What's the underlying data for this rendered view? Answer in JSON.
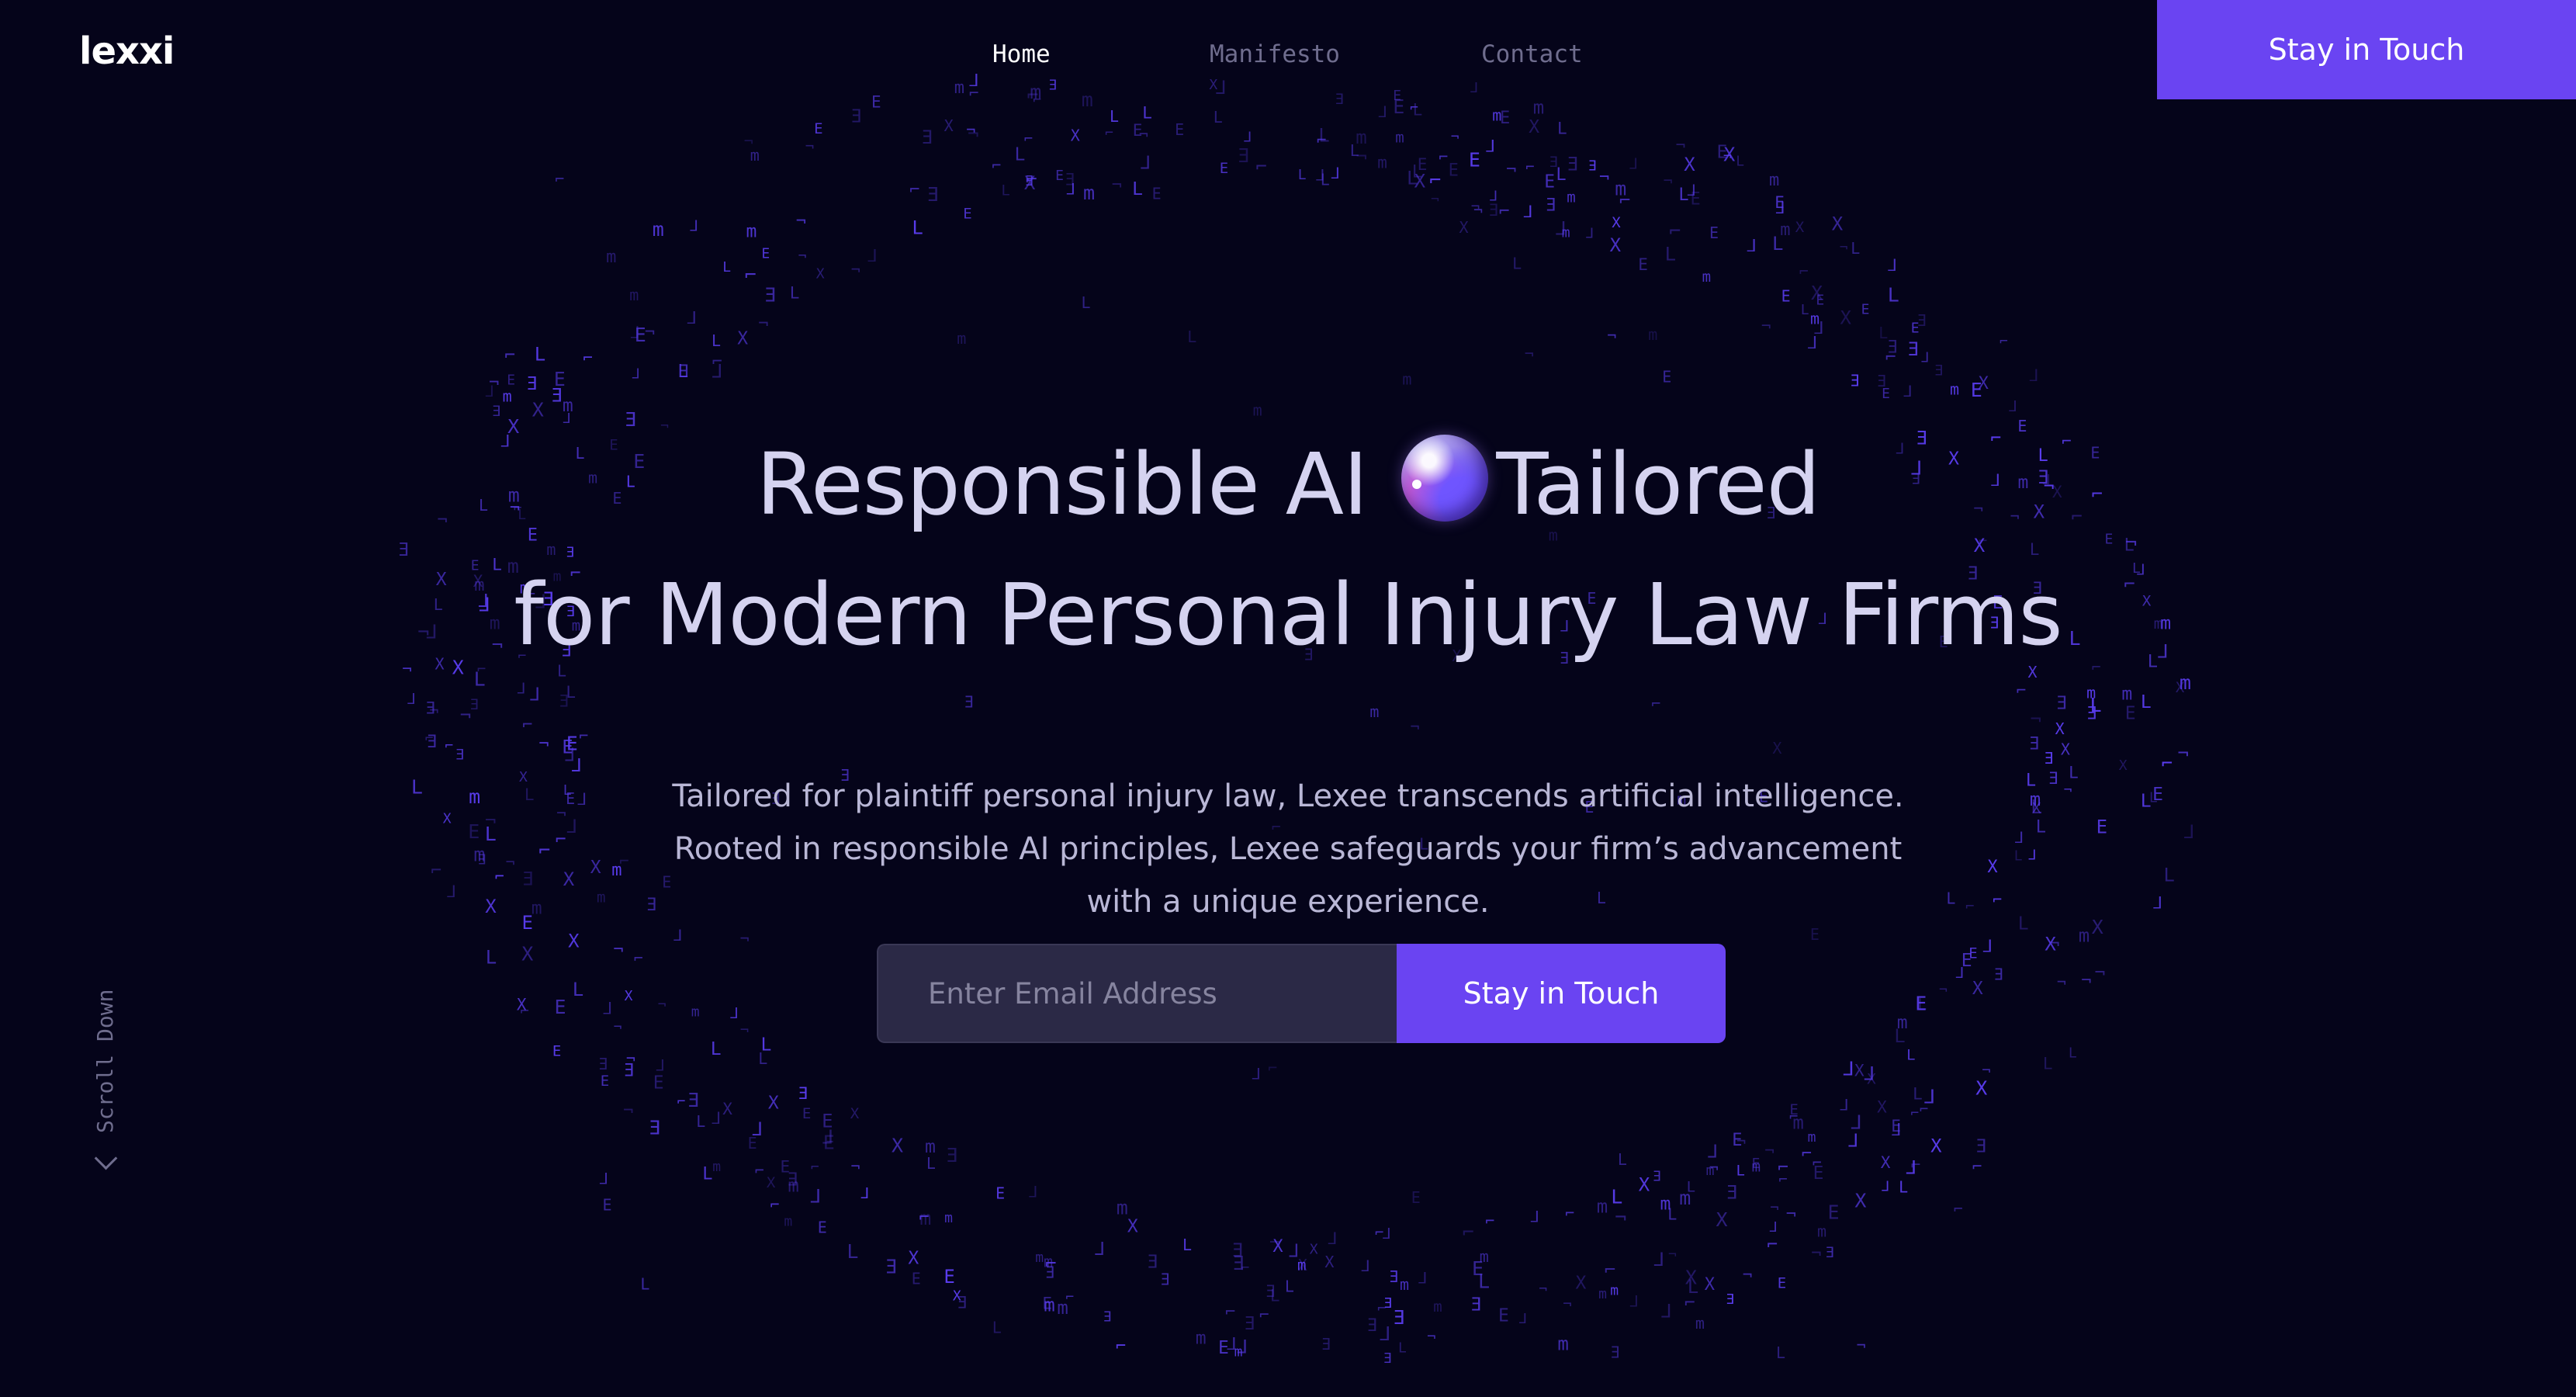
{
  "brand": {
    "logo_text": "lexxi"
  },
  "nav": {
    "items": [
      {
        "label": "Home",
        "active": true
      },
      {
        "label": "Manifesto",
        "active": false
      },
      {
        "label": "Contact",
        "active": false
      }
    ],
    "cta_label": "Stay in Touch"
  },
  "hero": {
    "headline_line1_before": "Responsible AI",
    "headline_line1_after": "Tailored",
    "headline_line2": "for Modern Personal Injury Law Firms",
    "orb_icon": "gradient-orb-icon",
    "subtext_line1": "Tailored for plaintiff personal injury law, Lexee transcends artificial intelligence.",
    "subtext_line2": "Rooted in responsible AI principles, Lexee safeguards your firm’s advancement",
    "subtext_line3": "with a unique experience."
  },
  "signup": {
    "email_placeholder": "Enter Email Address",
    "email_value": "",
    "submit_label": "Stay in Touch"
  },
  "scroll": {
    "label": "Scroll Down",
    "icon": "chevron-down-icon"
  },
  "background": {
    "pattern": "particle ring of letters",
    "glyphs": [
      "L",
      "E",
      "X",
      "Ǝ",
      "⅃",
      "m",
      "⌐",
      "¬"
    ]
  },
  "colors": {
    "background": "#05041a",
    "accent": "#6a44f2",
    "headline": "#d5d3f0",
    "body_text": "#b9b7d6",
    "muted_nav": "#6f6d8e",
    "input_bg": "#2b2946",
    "particle": "#5a3df0"
  }
}
